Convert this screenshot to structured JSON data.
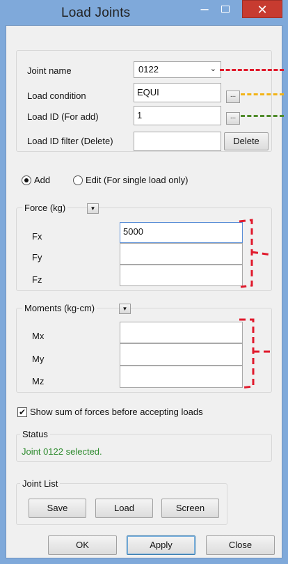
{
  "window": {
    "title": "Load Joints",
    "minimize_glyph": "–",
    "close_glyph": "✕"
  },
  "joint": {
    "name_label": "Joint name",
    "name_value": "0122",
    "load_condition_label": "Load condition",
    "load_condition_value": "EQUI",
    "load_id_label": "Load ID (For add)",
    "load_id_value": "1",
    "filter_label": "Load ID filter (Delete)",
    "filter_value": "",
    "browse_label": "...",
    "delete_label": "Delete"
  },
  "mode": {
    "add_label": "Add",
    "edit_label": "Edit (For single load only)",
    "selected": "add"
  },
  "force": {
    "legend": "Force (kg)",
    "fx_label": "Fx",
    "fx_value": "5000",
    "fy_label": "Fy",
    "fy_value": "",
    "fz_label": "Fz",
    "fz_value": ""
  },
  "moments": {
    "legend": "Moments (kg-cm)",
    "mx_label": "Mx",
    "mx_value": "",
    "my_label": "My",
    "my_value": "",
    "mz_label": "Mz",
    "mz_value": ""
  },
  "show_sum": {
    "label": "Show sum of forces before accepting loads",
    "checked": true
  },
  "status": {
    "legend": "Status",
    "text": "Joint 0122 selected."
  },
  "joint_list": {
    "legend": "Joint List",
    "save_label": "Save",
    "load_label": "Load",
    "screen_label": "Screen"
  },
  "footer": {
    "ok_label": "OK",
    "apply_label": "Apply",
    "close_label": "Close"
  },
  "colors": {
    "titlebar": "#7fa9da",
    "close_button": "#c73b30",
    "status_text": "#2e8b2e",
    "annotation_red": "#e0192b",
    "annotation_yellow": "#f2b316",
    "annotation_green": "#4f8a2a"
  }
}
